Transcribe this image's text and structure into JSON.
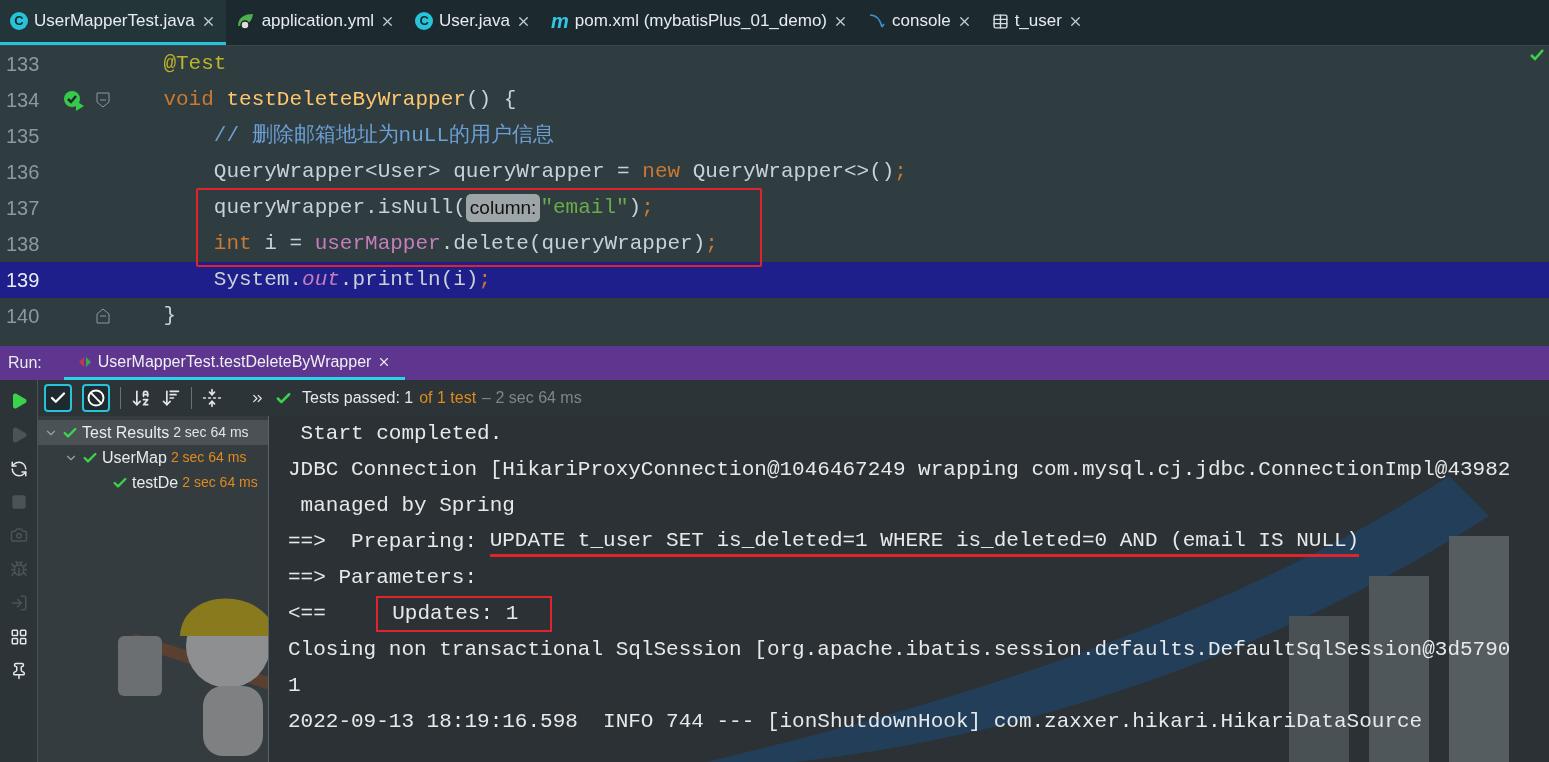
{
  "tabs": [
    {
      "label": "UserMapperTest.java",
      "kind": "class",
      "icon_char": "C",
      "selected": true
    },
    {
      "label": "application.yml",
      "kind": "spring",
      "selected": false
    },
    {
      "label": "User.java",
      "kind": "class",
      "icon_char": "C",
      "selected": false
    },
    {
      "label": "pom.xml (mybatisPlus_01_demo)",
      "kind": "maven",
      "icon_char": "m",
      "selected": false
    },
    {
      "label": "console",
      "kind": "database",
      "selected": false
    },
    {
      "label": "t_user",
      "kind": "table",
      "selected": false
    }
  ],
  "editor": {
    "lines": [
      {
        "number": "133",
        "runnable": false,
        "fold_start": false,
        "fold_end": false,
        "selected": false,
        "boxed": false,
        "tokens": [
          {
            "kind": "annotation",
            "text": "    @Test"
          }
        ]
      },
      {
        "number": "134",
        "runnable": true,
        "fold_start": true,
        "fold_end": false,
        "selected": false,
        "boxed": false,
        "tokens": [
          {
            "kind": "keyword",
            "text": "    void "
          },
          {
            "kind": "method",
            "text": "testDeleteByWrapper"
          },
          {
            "kind": "plain",
            "text": "() {"
          }
        ]
      },
      {
        "number": "135",
        "runnable": false,
        "fold_start": false,
        "fold_end": false,
        "selected": false,
        "boxed": false,
        "tokens": [
          {
            "kind": "comment",
            "text": "        // 删除邮箱地址为nuLL的用户信息"
          }
        ]
      },
      {
        "number": "136",
        "runnable": false,
        "fold_start": false,
        "fold_end": false,
        "selected": false,
        "boxed": false,
        "tokens": [
          {
            "kind": "plain",
            "text": "        QueryWrapper<User> queryWrapper = "
          },
          {
            "kind": "keyword",
            "text": "new"
          },
          {
            "kind": "plain",
            "text": " QueryWrapper<>()"
          },
          {
            "kind": "punct",
            "text": ";"
          }
        ]
      },
      {
        "number": "137",
        "runnable": false,
        "fold_start": false,
        "fold_end": false,
        "selected": false,
        "boxed": true,
        "tokens": [
          {
            "kind": "plain",
            "text": "        queryWrapper.isNull("
          },
          {
            "kind": "hint",
            "text": "column:"
          },
          {
            "kind": "string",
            "text": "\"email\""
          },
          {
            "kind": "plain",
            "text": ")"
          },
          {
            "kind": "punct",
            "text": ";"
          }
        ]
      },
      {
        "number": "138",
        "runnable": false,
        "fold_start": false,
        "fold_end": false,
        "selected": false,
        "boxed": true,
        "tokens": [
          {
            "kind": "keyword",
            "text": "        int"
          },
          {
            "kind": "plain",
            "text": " i = "
          },
          {
            "kind": "field",
            "text": "userMapper"
          },
          {
            "kind": "plain",
            "text": ".delete(queryWrapper)"
          },
          {
            "kind": "punct",
            "text": ";"
          }
        ]
      },
      {
        "number": "139",
        "runnable": false,
        "fold_start": false,
        "fold_end": false,
        "selected": true,
        "boxed": false,
        "tokens": [
          {
            "kind": "plain",
            "text": "        System."
          },
          {
            "kind": "static",
            "text": "out"
          },
          {
            "kind": "plain",
            "text": ".println(i)"
          },
          {
            "kind": "punct",
            "text": ";"
          }
        ]
      },
      {
        "number": "140",
        "runnable": false,
        "fold_start": false,
        "fold_end": true,
        "selected": false,
        "boxed": false,
        "tokens": [
          {
            "kind": "plain",
            "text": "    }"
          }
        ]
      }
    ]
  },
  "run": {
    "label": "Run:",
    "tab": {
      "label": "UserMapperTest.testDeleteByWrapper",
      "selected": true
    }
  },
  "side_icons": [
    {
      "kind": "run",
      "disabled": false
    },
    {
      "kind": "rerun-failed",
      "disabled": true
    },
    {
      "kind": "rerun-auto",
      "disabled": false
    },
    {
      "kind": "stop",
      "disabled": true
    },
    {
      "kind": "camera",
      "disabled": true
    },
    {
      "kind": "bug",
      "disabled": true
    },
    {
      "kind": "import",
      "disabled": true
    },
    {
      "kind": "layout",
      "disabled": false
    },
    {
      "kind": "pin",
      "disabled": false
    }
  ],
  "toolbar": {
    "toggles": [
      {
        "kind": "passed",
        "selected": true
      },
      {
        "kind": "ignored",
        "selected": true
      }
    ],
    "status": [
      {
        "kind": "normal",
        "text": "Tests passed: 1"
      },
      {
        "kind": "accent",
        "text": "of 1 test"
      },
      {
        "kind": "muted",
        "text": "– 2 sec 64 ms"
      }
    ]
  },
  "tree": [
    {
      "label": "Test Results",
      "time": "2 sec 64 ms",
      "selected": true,
      "expanded": true,
      "children": [
        {
          "label": "UserMap",
          "time": "2 sec 64 ms",
          "selected": false,
          "expanded": true,
          "children": [
            {
              "label": "testDe",
              "time": "2 sec 64 ms",
              "selected": false
            }
          ]
        }
      ]
    }
  ],
  "console": [
    {
      "tokens": [
        {
          "text": " Start completed."
        }
      ]
    },
    {
      "tokens": [
        {
          "text": "JDBC Connection [HikariProxyConnection@1046467249 wrapping com.mysql.cj.jdbc.ConnectionImpl@43982"
        }
      ]
    },
    {
      "tokens": [
        {
          "text": " managed by Spring"
        }
      ]
    },
    {
      "tokens": [
        {
          "text": "==>  Preparing: ",
          "underlined": false,
          "boxed": false
        },
        {
          "text": "UPDATE t_user SET is_deleted=1 WHERE is_deleted=0 AND (email IS NULL)",
          "underlined": true,
          "boxed": false
        }
      ]
    },
    {
      "tokens": [
        {
          "text": "==> Parameters:"
        }
      ]
    },
    {
      "tokens": [
        {
          "text": "<==    ",
          "underlined": false,
          "boxed": false
        },
        {
          "text": "Updates: 1",
          "underlined": false,
          "boxed": true
        }
      ]
    },
    {
      "tokens": [
        {
          "text": "Closing non transactional SqlSession [org.apache.ibatis.session.defaults.DefaultSqlSession@3d5790"
        }
      ]
    },
    {
      "tokens": [
        {
          "text": "1"
        }
      ]
    },
    {
      "tokens": [
        {
          "text": "2022-09-13 18:19:16.598  INFO 744 --- [ionShutdownHook] com.zaxxer.hikari.HikariDataSource"
        }
      ]
    }
  ]
}
